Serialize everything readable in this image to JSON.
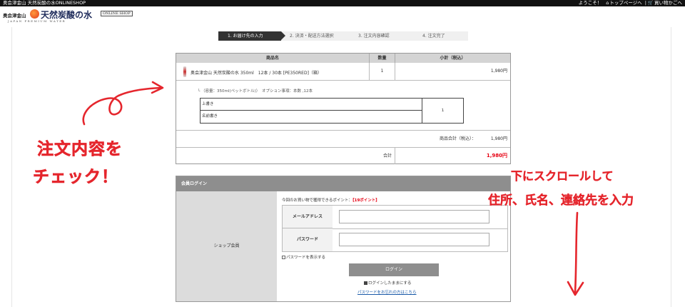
{
  "topbar": {
    "site_name": "奥会津金山 天然炭酸の水ONLINESHOP",
    "welcome": "ようこそ！",
    "home_link": "トップページへ",
    "cart_link": "買い物かごへ"
  },
  "logo": {
    "small": "奥会津金山",
    "big": "天然炭酸の水",
    "badge": "ONLINE SHOP",
    "tagline": "JAPAN PREMIUM WATER"
  },
  "steps": [
    {
      "label": "1.  お届け先の入力",
      "active": true
    },
    {
      "label": "2.  決済・配送方法選択",
      "active": false
    },
    {
      "label": "3.  注文内容確認",
      "active": false
    },
    {
      "label": "4.  注文完了",
      "active": false
    }
  ],
  "order": {
    "headers": {
      "name": "商品名",
      "qty": "数量",
      "subtotal": "小計（税込）"
    },
    "item": {
      "name": "奥会津金山 天然炭酸の水 350ml　12本 / 30本 [PE350RED]（箱）",
      "qty": "1",
      "subtotal": "1,980円"
    },
    "option_note": "└ （容量：350ml(ペットボトル)）　オプション事項：本数 ,12本",
    "option_rows": [
      "上書き",
      "名前書き"
    ],
    "option_qty": "1",
    "product_total_label": "商品合計（税込）：",
    "product_total": "1,980円",
    "total_label": "合計",
    "total": "1,980円"
  },
  "login": {
    "header": "会員ログイン",
    "member_label": "ショップ会員",
    "points_text": "今回のお買い物で獲得できるポイント：",
    "points_value": "【19ポイント】",
    "email_label": "メールアドレス",
    "password_label": "パスワード",
    "email_value": "",
    "password_value": "",
    "show_password": "パスワードを表示する",
    "login_button": "ログイン",
    "keep_logged_in": "ログインしたままにする",
    "forgot_link": "パスワードをお忘れの方はこちら"
  },
  "annotations": {
    "left_line1": "注文内容を",
    "left_line2": "チェック！",
    "right_line1": "下にスクロールして",
    "right_line2": "住所、氏名、連絡先を入力"
  },
  "colors": {
    "accent_red": "#e60012",
    "annotation_red": "#e5262d",
    "step_active": "#333333",
    "header_gray": "#8e8e8e"
  }
}
